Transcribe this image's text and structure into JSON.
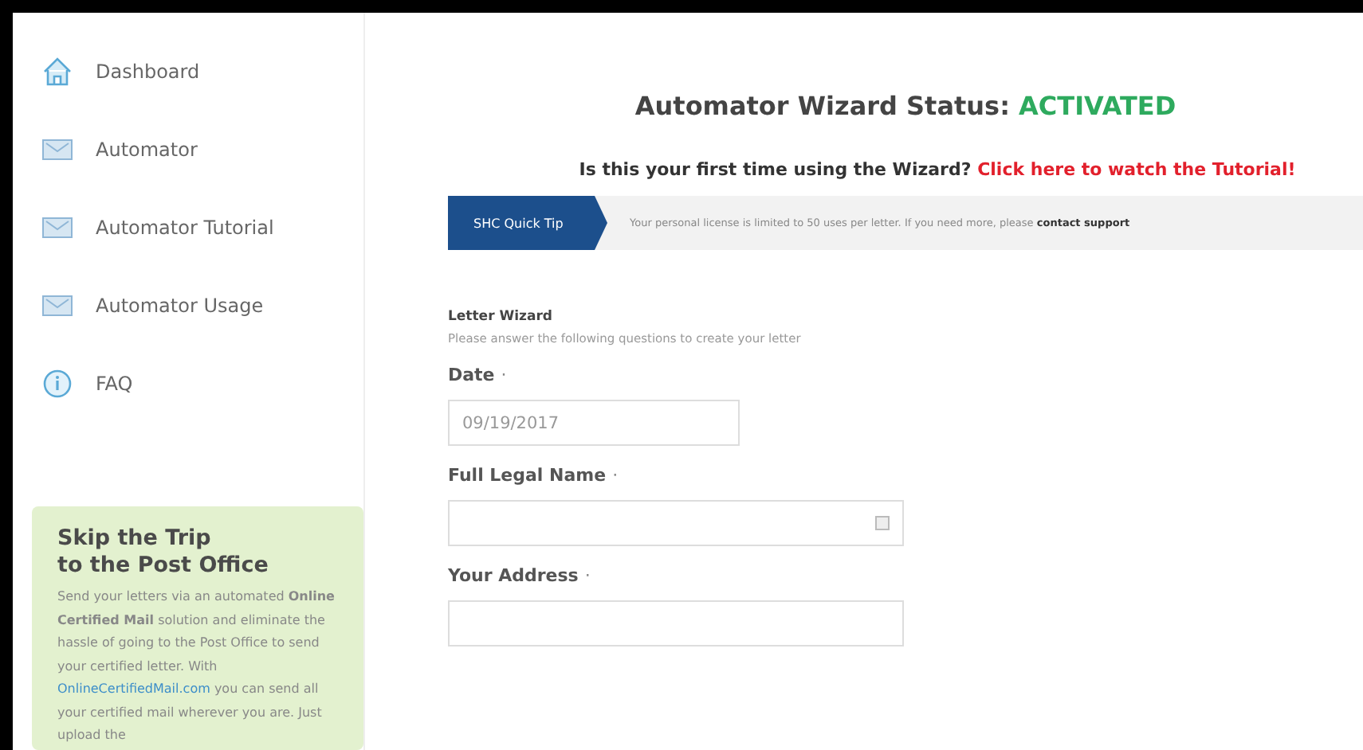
{
  "sidebar": {
    "items": [
      {
        "label": "Dashboard",
        "kind": "home",
        "selected": false
      },
      {
        "label": "Automator",
        "kind": "mail",
        "selected": false
      },
      {
        "label": "Automator Tutorial",
        "kind": "mail",
        "selected": false
      },
      {
        "label": "Automator Usage",
        "kind": "mail",
        "selected": false
      },
      {
        "label": "FAQ",
        "kind": "info",
        "selected": false
      }
    ],
    "promo": {
      "title_lines": [
        "Skip the Trip",
        "to the Post Office"
      ],
      "text_before": "Send your letters via an automated **Online Certified Mail** solution and eliminate the hassle of going to the Post Office to send your certified letter. With",
      "link": "OnlineCertifiedMail.com",
      "text_after": "you can send all your certified mail wherever you are. Just upload the"
    }
  },
  "main": {
    "title": "Automator Wizard Status:",
    "status": "ACTIVATED",
    "prompt": "Is this your first time using the Wizard?",
    "tutorial_link": "Click here to watch the Tutorial!",
    "tip": {
      "tag": "SHC Quick Tip",
      "text": "Your personal license is limited to 50 uses per letter. If you need more, please",
      "link": "contact support"
    },
    "form": {
      "title": "Letter Wizard",
      "description": "Please answer the following questions to create your letter",
      "fields": [
        {
          "label": "Date",
          "required_mark": "·",
          "value": "09/19/2017",
          "kind": "date"
        },
        {
          "label": "Full Legal Name",
          "required_mark": "·",
          "kind": "contact"
        },
        {
          "label": "Your Address",
          "required_mark": "·",
          "kind": "text"
        }
      ]
    }
  }
}
